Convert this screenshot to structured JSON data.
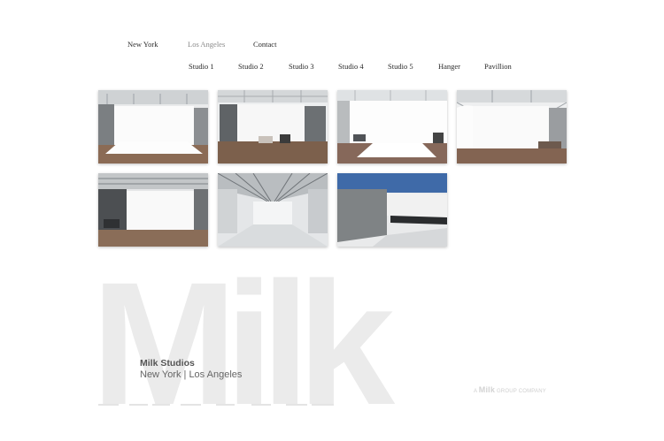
{
  "nav": {
    "cities": [
      "New York",
      "Los Angeles",
      "Contact"
    ],
    "active_city": "Los Angeles",
    "studios": [
      "Studio 1",
      "Studio 2",
      "Studio 3",
      "Studio 4",
      "Studio 5",
      "Hanger",
      "Pavillion"
    ]
  },
  "gallery": {
    "photos": [
      "studio-photo-1",
      "studio-photo-2",
      "studio-photo-3",
      "studio-photo-4",
      "studio-photo-5",
      "hangar-photo",
      "pavillion-photo"
    ]
  },
  "brand": {
    "logo_text": "Milk",
    "name": "Milk Studios",
    "locations": "New York | Los Angeles",
    "group_prefix": "A",
    "group_brand": "Milk",
    "group_suffix": "GROUP COMPANY"
  },
  "colors": {
    "logo_watermark": "#ebebeb",
    "nav_text": "#2a2a2a",
    "nav_active": "#8a8a8a"
  }
}
